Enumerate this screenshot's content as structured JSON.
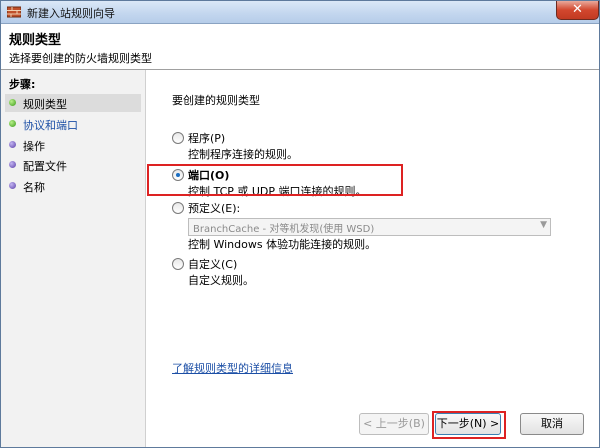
{
  "window": {
    "title": "新建入站规则向导",
    "close_glyph": "✕"
  },
  "header": {
    "title": "规则类型",
    "subtitle": "选择要创建的防火墙规则类型"
  },
  "sidebar": {
    "steps_label": "步骤:",
    "items": [
      {
        "label": "规则类型",
        "state": "current",
        "icon": "green-dot-icon"
      },
      {
        "label": "协议和端口",
        "state": "link",
        "icon": "green-dot-icon"
      },
      {
        "label": "操作",
        "state": "normal",
        "icon": "purple-dot-icon"
      },
      {
        "label": "配置文件",
        "state": "normal",
        "icon": "purple-dot-icon"
      },
      {
        "label": "名称",
        "state": "normal",
        "icon": "purple-dot-icon"
      }
    ]
  },
  "main": {
    "heading": "要创建的规则类型",
    "options": [
      {
        "title": "程序(P)",
        "desc": "控制程序连接的规则。",
        "checked": false
      },
      {
        "title": "端口(O)",
        "desc": "控制 TCP 或 UDP 端口连接的规则。",
        "checked": true
      },
      {
        "title": "预定义(E):",
        "desc": "控制 Windows 体验功能连接的规则。",
        "checked": false
      },
      {
        "title": "自定义(C)",
        "desc": "自定义规则。",
        "checked": false
      }
    ],
    "predefined_select": {
      "value": "BranchCache - 对等机发现(使用 WSD)"
    },
    "learn_more": "了解规则类型的详细信息"
  },
  "buttons": {
    "back": "< 上一步(B)",
    "next": "下一步(N) >",
    "cancel": "取消"
  },
  "colors": {
    "highlight": "#dd2222",
    "link": "#1c4fa6",
    "titlebar": "#c4d7ef"
  }
}
